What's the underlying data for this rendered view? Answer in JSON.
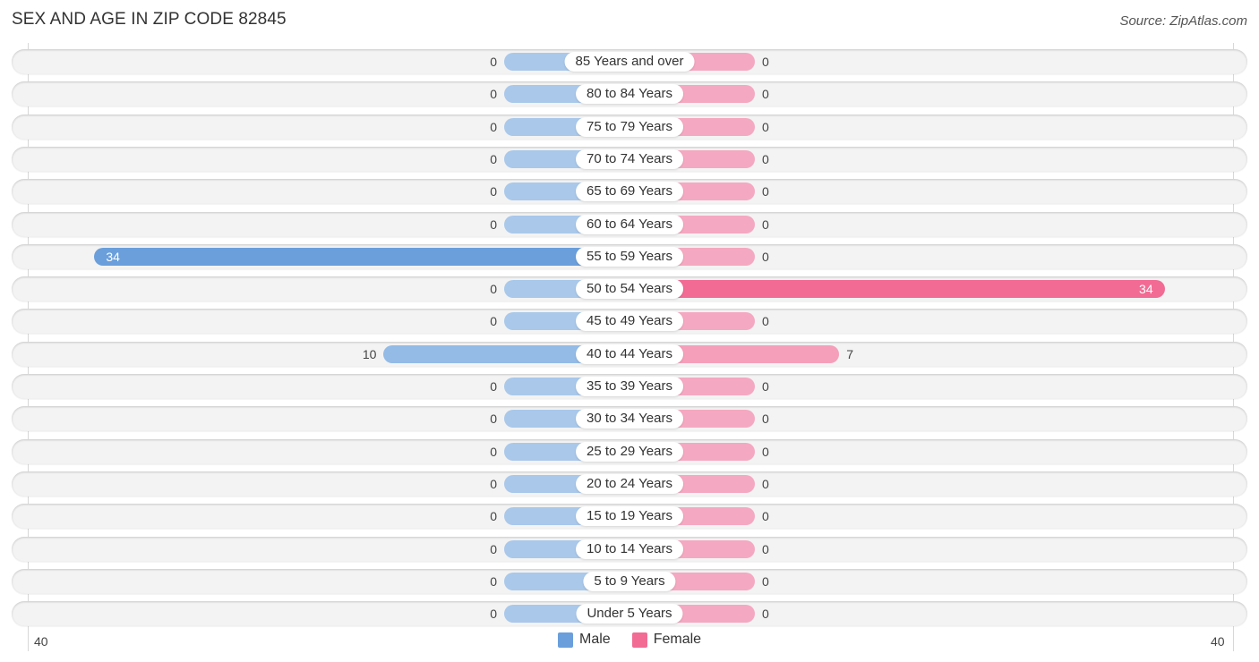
{
  "header": {
    "title": "SEX AND AGE IN ZIP CODE 82845",
    "source": "Source: ZipAtlas.com"
  },
  "chart_data": {
    "type": "bar",
    "orientation": "horizontal-diverging",
    "title": "SEX AND AGE IN ZIP CODE 82845",
    "categories": [
      "85 Years and over",
      "80 to 84 Years",
      "75 to 79 Years",
      "70 to 74 Years",
      "65 to 69 Years",
      "60 to 64 Years",
      "55 to 59 Years",
      "50 to 54 Years",
      "45 to 49 Years",
      "40 to 44 Years",
      "35 to 39 Years",
      "30 to 34 Years",
      "25 to 29 Years",
      "20 to 24 Years",
      "15 to 19 Years",
      "10 to 14 Years",
      "5 to 9 Years",
      "Under 5 Years"
    ],
    "series": [
      {
        "name": "Male",
        "color": "#6a9fdb",
        "values": [
          0,
          0,
          0,
          0,
          0,
          0,
          34,
          0,
          0,
          10,
          0,
          0,
          0,
          0,
          0,
          0,
          0,
          0
        ]
      },
      {
        "name": "Female",
        "color": "#f26b94",
        "values": [
          0,
          0,
          0,
          0,
          0,
          0,
          0,
          34,
          0,
          7,
          0,
          0,
          0,
          0,
          0,
          0,
          0,
          0
        ]
      }
    ],
    "axis": {
      "left_label": "40",
      "right_label": "40",
      "max": 40
    },
    "legend": {
      "position": "bottom-center",
      "items": [
        "Male",
        "Female"
      ]
    }
  }
}
